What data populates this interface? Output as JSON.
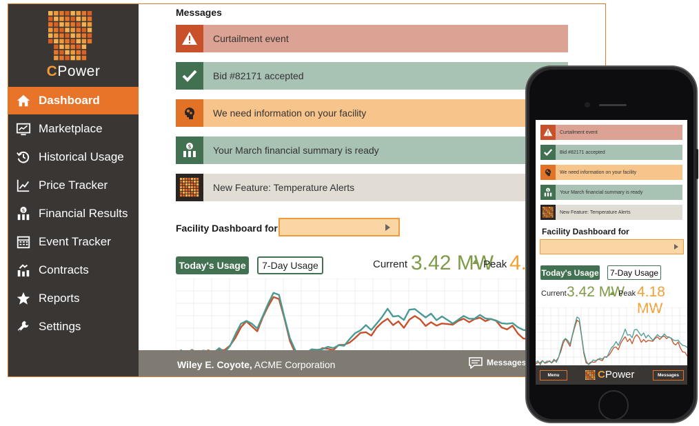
{
  "sidebar": {
    "brand": "Power",
    "brand_c": "C",
    "items": [
      {
        "label": "Dashboard",
        "icon": "home-icon",
        "active": true
      },
      {
        "label": "Marketplace",
        "icon": "chart-screen-icon"
      },
      {
        "label": "Historical Usage",
        "icon": "history-icon"
      },
      {
        "label": "Price Tracker",
        "icon": "trend-line-icon"
      },
      {
        "label": "Financial Results",
        "icon": "financial-bars-icon"
      },
      {
        "label": "Event Tracker",
        "icon": "calendar-icon"
      },
      {
        "label": "Contracts",
        "icon": "handshake-icon"
      },
      {
        "label": "Reports",
        "icon": "star-icon"
      },
      {
        "label": "Settings",
        "icon": "tools-icon"
      }
    ]
  },
  "messages": {
    "title": "Messages",
    "items": [
      {
        "text": "Curtailment event",
        "icon": "warning-icon",
        "color": "#c8502a"
      },
      {
        "text": "Bid #82171 accepted",
        "icon": "checkmark-icon",
        "color": "#417150"
      },
      {
        "text": "We need information on your facility",
        "icon": "head-gears-icon",
        "color": "#e17226"
      },
      {
        "text": "Your March financial summary is ready",
        "icon": "financial-bars-icon",
        "color": "#417150"
      },
      {
        "text": "New Feature: Temperature Alerts",
        "icon": "grid-logo-icon",
        "color": "#2a2522"
      }
    ]
  },
  "facility": {
    "label": "Facility Dashboard for",
    "selected": ""
  },
  "tabs": {
    "today": "Today's Usage",
    "seven_day": "7-Day Usage"
  },
  "stats": {
    "current_label": "Current",
    "current_value": "3.42 MW",
    "peak_label": "Peak",
    "peak_value_partial": "4.",
    "peak_value": "4.18 MW"
  },
  "footer": {
    "user_name": "Wiley E. Coyote,",
    "company": " ACME Corporation",
    "messages_label": "Messages"
  },
  "mobile": {
    "menu_label": "Menu",
    "messages_label": "Messages",
    "brand": "Power",
    "brand_c": "C"
  },
  "chart_data": {
    "type": "line",
    "title": "",
    "series": [
      {
        "color": "#4a9a94",
        "values": [
          10,
          12,
          8,
          14,
          9,
          11,
          13,
          10,
          15,
          12,
          20,
          35,
          48,
          55,
          50,
          42,
          62,
          78,
          92,
          88,
          60,
          30,
          12,
          8,
          10,
          14,
          12,
          16,
          18,
          15,
          22,
          20,
          28,
          35,
          42,
          48,
          40,
          52,
          60,
          70,
          58,
          62,
          55,
          68,
          72,
          65,
          58,
          62,
          56,
          60,
          54,
          52,
          56,
          60,
          55,
          58,
          62,
          56,
          58,
          55,
          50,
          48,
          52,
          45,
          40,
          42,
          38
        ]
      },
      {
        "color": "#c8502a",
        "values": [
          9,
          11,
          9,
          12,
          10,
          10,
          12,
          11,
          14,
          13,
          18,
          32,
          45,
          52,
          48,
          40,
          58,
          72,
          88,
          84,
          56,
          28,
          10,
          7,
          9,
          12,
          11,
          15,
          17,
          14,
          20,
          19,
          25,
          30,
          36,
          40,
          34,
          44,
          50,
          58,
          48,
          52,
          46,
          56,
          60,
          54,
          48,
          52,
          46,
          52,
          50,
          48,
          52,
          58,
          52,
          55,
          60,
          54,
          56,
          52,
          46,
          42,
          46,
          38,
          30,
          28,
          20
        ]
      }
    ],
    "grid": true
  }
}
